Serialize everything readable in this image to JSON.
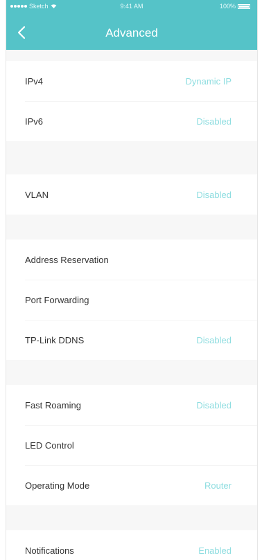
{
  "status_bar": {
    "carrier": "Sketch",
    "time": "9:41 AM",
    "battery": "100%"
  },
  "header": {
    "title": "Advanced",
    "back_icon": "chevron-left-icon"
  },
  "colors": {
    "header_bg": "#55c3c8",
    "value_text": "#8edde0",
    "label_text": "#333333",
    "section_gap": "#f7f7f7"
  },
  "sections": [
    {
      "items": [
        {
          "label": "IPv4",
          "value": "Dynamic IP"
        },
        {
          "label": "IPv6",
          "value": "Disabled"
        }
      ]
    },
    {
      "items": [
        {
          "label": "VLAN",
          "value": "Disabled"
        }
      ]
    },
    {
      "items": [
        {
          "label": "Address Reservation",
          "value": ""
        },
        {
          "label": "Port Forwarding",
          "value": ""
        },
        {
          "label": "TP-Link DDNS",
          "value": "Disabled"
        }
      ]
    },
    {
      "items": [
        {
          "label": "Fast Roaming",
          "value": "Disabled"
        },
        {
          "label": "LED Control",
          "value": ""
        },
        {
          "label": "Operating Mode",
          "value": "Router"
        }
      ]
    },
    {
      "items": [
        {
          "label": "Notifications",
          "value": "Enabled"
        }
      ]
    }
  ]
}
